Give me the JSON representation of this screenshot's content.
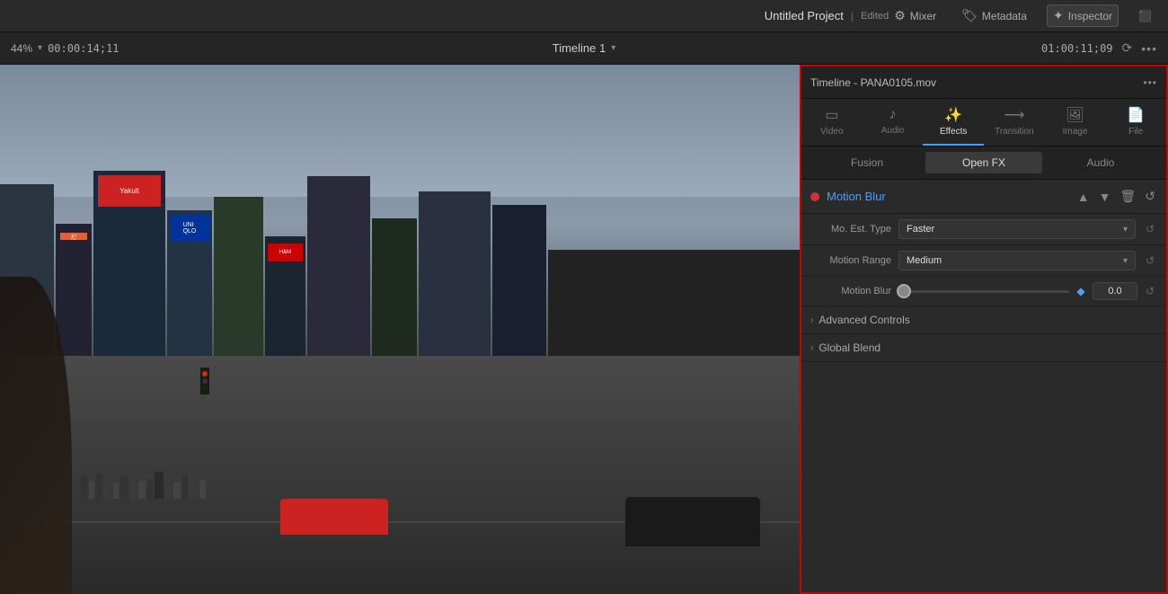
{
  "titleBar": {
    "projectName": "Untitled Project",
    "status": "Edited",
    "mixer": "Mixer",
    "metadata": "Metadata",
    "inspector": "Inspector"
  },
  "timelineToolbar": {
    "zoom": "44%",
    "timecode": "00:00:14;11",
    "timelineName": "Timeline 1",
    "rightTimecode": "01:00:11;09",
    "moreOptions": "•••"
  },
  "inspectorHeader": {
    "title": "Timeline - PANA0105.mov",
    "moreOptions": "•••"
  },
  "inspectorTabs": [
    {
      "id": "video",
      "icon": "🎬",
      "label": "Video"
    },
    {
      "id": "audio",
      "icon": "🎵",
      "label": "Audio"
    },
    {
      "id": "effects",
      "icon": "✨",
      "label": "Effects",
      "active": true
    },
    {
      "id": "transition",
      "icon": "⟶",
      "label": "Transition"
    },
    {
      "id": "image",
      "icon": "🖼",
      "label": "Image"
    },
    {
      "id": "file",
      "icon": "📄",
      "label": "File"
    }
  ],
  "subTabs": [
    {
      "id": "fusion",
      "label": "Fusion"
    },
    {
      "id": "openfx",
      "label": "Open FX",
      "active": true
    },
    {
      "id": "audio",
      "label": "Audio"
    }
  ],
  "motionBlur": {
    "title": "Motion Blur",
    "dotColor": "#cc3333",
    "params": {
      "moEstType": {
        "label": "Mo. Est. Type",
        "value": "Faster"
      },
      "motionRange": {
        "label": "Motion Range",
        "value": "Medium"
      },
      "motionBlur": {
        "label": "Motion Blur",
        "value": "0.0",
        "sliderPercent": 0
      }
    },
    "sections": [
      {
        "id": "advanced",
        "label": "Advanced Controls"
      },
      {
        "id": "global",
        "label": "Global Blend"
      }
    ]
  },
  "icons": {
    "upArrow": "▲",
    "downArrow": "▼",
    "reset": "↺",
    "trash": "🗑",
    "diamond": "◆",
    "chevronDown": "▾",
    "chevronRight": "›",
    "expand": "›",
    "sync": "⟳",
    "more": "•••"
  }
}
